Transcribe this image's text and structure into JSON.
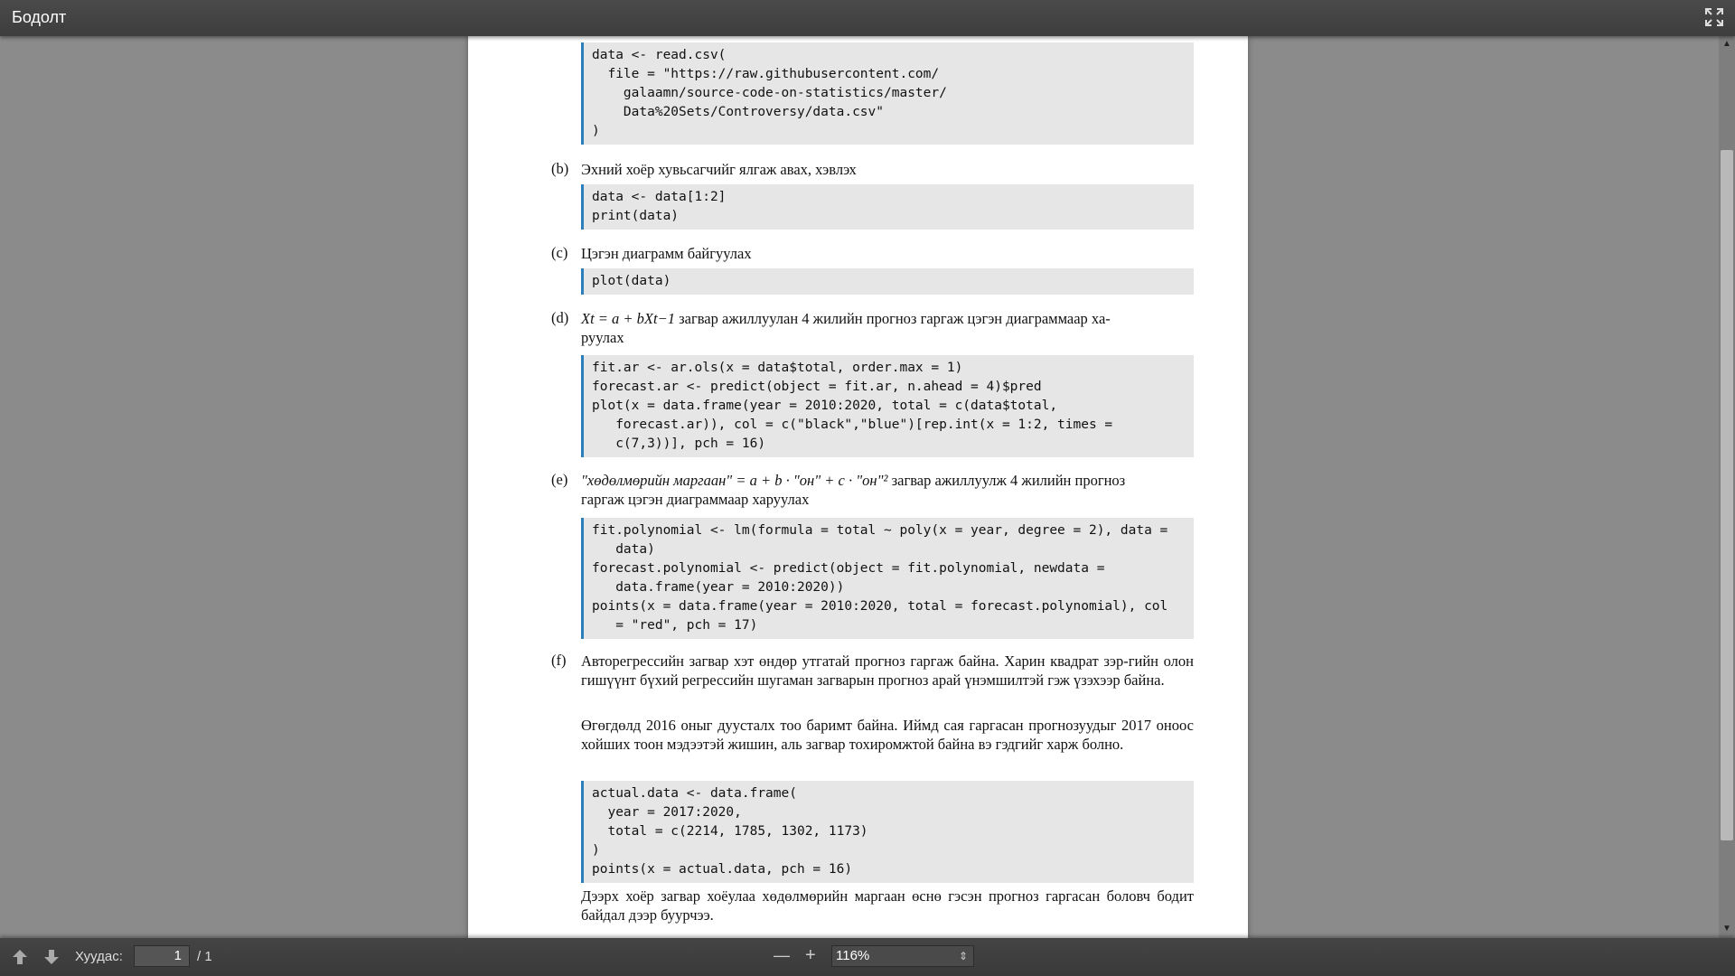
{
  "header": {
    "title": "Бодолт"
  },
  "toolbar": {
    "page_label": "Хуудас:",
    "page_value": "1",
    "page_total": "/ 1",
    "zoom_out": "—",
    "zoom_in": "+",
    "zoom_value": "116%",
    "zoom_arrows": "⇕"
  },
  "doc": {
    "code_a": [
      "data <- read.csv(",
      "  file = \"https://raw.githubusercontent.com/",
      "    galaamn/source-code-on-statistics/master/",
      "    Data%20Sets/Controversy/data.csv\"",
      ")"
    ],
    "b_label": "(b)",
    "b_text": "Эхний хоёр хувьсагчийг ялгаж авах, хэвлэх",
    "code_b": [
      "data <- data[1:2]",
      "print(data)"
    ],
    "c_label": "(c)",
    "c_text": "Цэгэн диаграмм байгуулах",
    "code_c": [
      "plot(data)"
    ],
    "d_label": "(d)",
    "d_text_1": "загвар ажиллуулан 4 жилийн прогноз гаргаж цэгэн диаграммаар ха-",
    "d_text_2": "руулах",
    "d_formula": "Xt = a + bXt−1",
    "code_d": [
      "fit.ar <- ar.ols(x = data$total, order.max = 1)",
      "forecast.ar <- predict(object = fit.ar, n.ahead = 4)$pred",
      "plot(x = data.frame(year = 2010:2020, total = c(data$total,",
      "   forecast.ar)), col = c(\"black\",\"blue\")[rep.int(x = 1:2, times =",
      "   c(7,3))], pch = 16)"
    ],
    "e_label": "(e)",
    "e_formula": "\"хөдөлмөрийн маргаан\" = a + b · \"он\" + c · \"он\"²",
    "e_text_1": "загвар ажиллуулж 4 жилийн прогноз",
    "e_text_2": "гаргаж цэгэн диаграммаар харуулах",
    "code_e": [
      "fit.polynomial <- lm(formula = total ~ poly(x = year, degree = 2), data =",
      "   data)",
      "forecast.polynomial <- predict(object = fit.polynomial, newdata =",
      "   data.frame(year = 2010:2020))",
      "points(x = data.frame(year = 2010:2020, total = forecast.polynomial), col",
      "   = \"red\", pch = 17)"
    ],
    "f_label": "(f)",
    "f_para1": "Авторегрессийн загвар хэт өндөр утгатай прогноз гаргаж байна. Харин квадрат зэр-гийн олон гишүүнт бүхий регрессийн шугаман загварын прогноз арай үнэмшилтэй гэж үзэхээр байна.",
    "f_para2": "Өгөгдөлд 2016 оныг дуусталх тоо баримт байна. Иймд сая гаргасан прогнозуудыг 2017 оноос хойших тоон мэдээтэй жишин, аль загвар тохиромжтой байна вэ гэдгийг харж болно.",
    "code_f": [
      "actual.data <- data.frame(",
      "  year = 2017:2020,",
      "  total = c(2214, 1785, 1302, 1173)",
      ")",
      "points(x = actual.data, pch = 16)"
    ],
    "final_para": "Дээрх хоёр загвар хоёулаа хөдөлмөрийн маргаан өснө гэсэн прогноз гаргасан боловч бодит байдал дээр буурчээ."
  }
}
